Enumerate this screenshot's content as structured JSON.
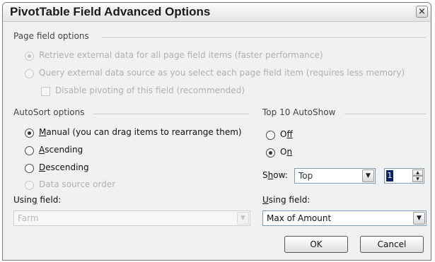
{
  "dialog": {
    "title": "PivotTable Field Advanced Options",
    "close_glyph": "×"
  },
  "page_field_options": {
    "title": "Page field options",
    "option_retrieve": "Retrieve external data for all page field items (faster performance)",
    "option_query": "Query external data source as you select each page field item (requires less memory)",
    "disable_pivoting": "Disable pivoting of this field (recommended)"
  },
  "autosort": {
    "title": "AutoSort options",
    "manual_key": "M",
    "manual_rest": "anual (you can drag items to rearrange them)",
    "ascending_key": "A",
    "ascending_rest": "scending",
    "descending_key": "D",
    "descending_rest": "escending",
    "data_source_order": "Data source order",
    "using_field_pre": "Usin",
    "using_field_key": "g",
    "using_field_post": " field:",
    "using_field_value": "Farm",
    "selected": "Manual"
  },
  "top10": {
    "title": "Top 10 AutoShow",
    "off_pre": "O",
    "off_key": "f",
    "off_post": "f",
    "on_pre": "O",
    "on_key": "n",
    "show_pre": "S",
    "show_key": "h",
    "show_post": "ow:",
    "show_value": "Top",
    "count_value": "1",
    "using_field_key": "U",
    "using_field_rest": "sing field:",
    "using_field_value": "Max of Amount",
    "selected": "On"
  },
  "buttons": {
    "ok": "OK",
    "cancel": "Cancel"
  }
}
